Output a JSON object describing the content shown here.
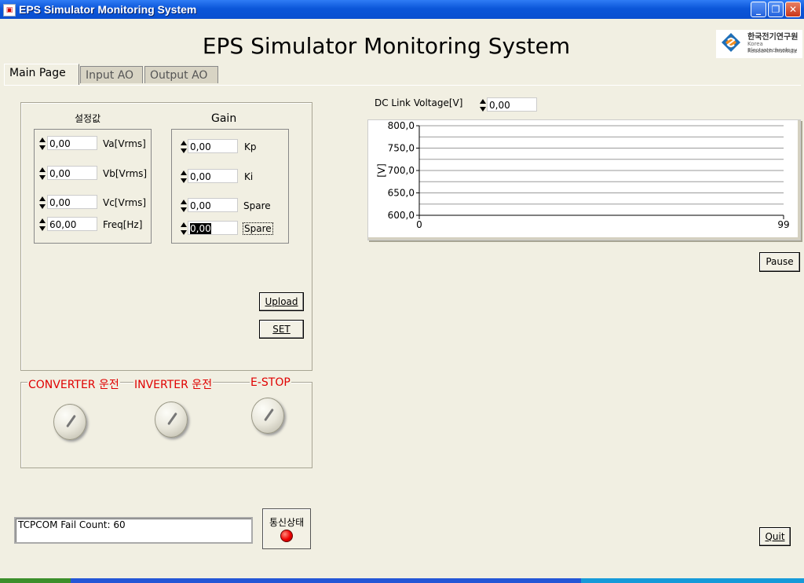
{
  "window": {
    "title": "EPS Simulator Monitoring System",
    "controls": {
      "minimize": "_",
      "restore": "❐",
      "close": "✕"
    }
  },
  "header": {
    "heading": "EPS Simulator Monitoring System",
    "logo": {
      "kr": "한국전기연구원",
      "en_line1": "Korea Electrotechnology",
      "en_line2": "Research Institute"
    }
  },
  "tabs": [
    {
      "label": "Main Page",
      "active": true
    },
    {
      "label": "Input AO",
      "active": false
    },
    {
      "label": "Output AO",
      "active": false
    }
  ],
  "setpoints": {
    "title": "설정값",
    "rows": [
      {
        "value": "0,00",
        "label": "Va[Vrms]"
      },
      {
        "value": "0,00",
        "label": "Vb[Vrms]"
      },
      {
        "value": "0,00",
        "label": "Vc[Vrms]"
      },
      {
        "value": "60,00",
        "label": "Freq[Hz]"
      }
    ]
  },
  "gain": {
    "title": "Gain",
    "rows": [
      {
        "value": "0,00",
        "label": "Kp"
      },
      {
        "value": "0,00",
        "label": "Ki"
      },
      {
        "value": "0,00",
        "label": "Spare"
      },
      {
        "value": "0,00",
        "label": "Spare"
      }
    ]
  },
  "buttons": {
    "upload": "Upload",
    "set": "SET",
    "pause": "Pause",
    "quit": "Quit"
  },
  "switches": [
    "CONVERTER 운전",
    "INVERTER 운전",
    "E-STOP"
  ],
  "dc_link": {
    "label": "DC Link  Voltage[V]",
    "value": "0,00"
  },
  "chart_data": {
    "type": "line",
    "ylabel": "[V]",
    "ylim": [
      600,
      800
    ],
    "xlim": [
      0,
      99
    ],
    "y_ticks": [
      "800,0",
      "750,0",
      "700,0",
      "650,0",
      "600,0"
    ],
    "x_ticks": [
      "0",
      "99"
    ],
    "grid": true,
    "series": []
  },
  "status": {
    "text": "TCPCOM Fail Count: 60",
    "comm_label": "통신상태",
    "led_color": "#e00000"
  }
}
